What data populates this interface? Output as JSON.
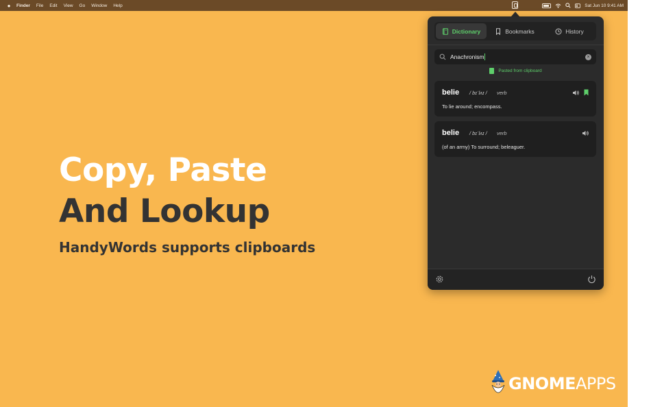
{
  "menubar": {
    "app_name": "Finder",
    "items": [
      "File",
      "Edit",
      "View",
      "Go",
      "Window",
      "Help"
    ],
    "clock": "Sat Jun 10  9:41 AM"
  },
  "headline": {
    "line1": "Copy, Paste",
    "line2": "And Lookup",
    "subline": "HandyWords supports clipboards"
  },
  "popover": {
    "tabs": [
      {
        "label": "Dictionary",
        "icon": "book-icon",
        "active": true
      },
      {
        "label": "Bookmarks",
        "icon": "bookmark-icon",
        "active": false
      },
      {
        "label": "History",
        "icon": "history-icon",
        "active": false
      }
    ],
    "search": {
      "value": "Anachronism",
      "placeholder": "Search"
    },
    "pasted_note": "Pasted from clipboard",
    "results": [
      {
        "word": "belie",
        "phonetic": "/ bɪˈlʌɪ /",
        "pos": "verb",
        "definition": "To lie around; encompass.",
        "bookmarked": true
      },
      {
        "word": "belie",
        "phonetic": "/ bɪˈlʌɪ /",
        "pos": "verb",
        "definition": "(of an army) To surround; beleaguer.",
        "bookmarked": false
      }
    ]
  },
  "brand": {
    "part1": "GNOME",
    "part2": "APPS"
  },
  "colors": {
    "background": "#f9b74f",
    "accent": "#5ecf6b",
    "panel": "#2b2b2b",
    "menubar": "#6b4a27"
  }
}
